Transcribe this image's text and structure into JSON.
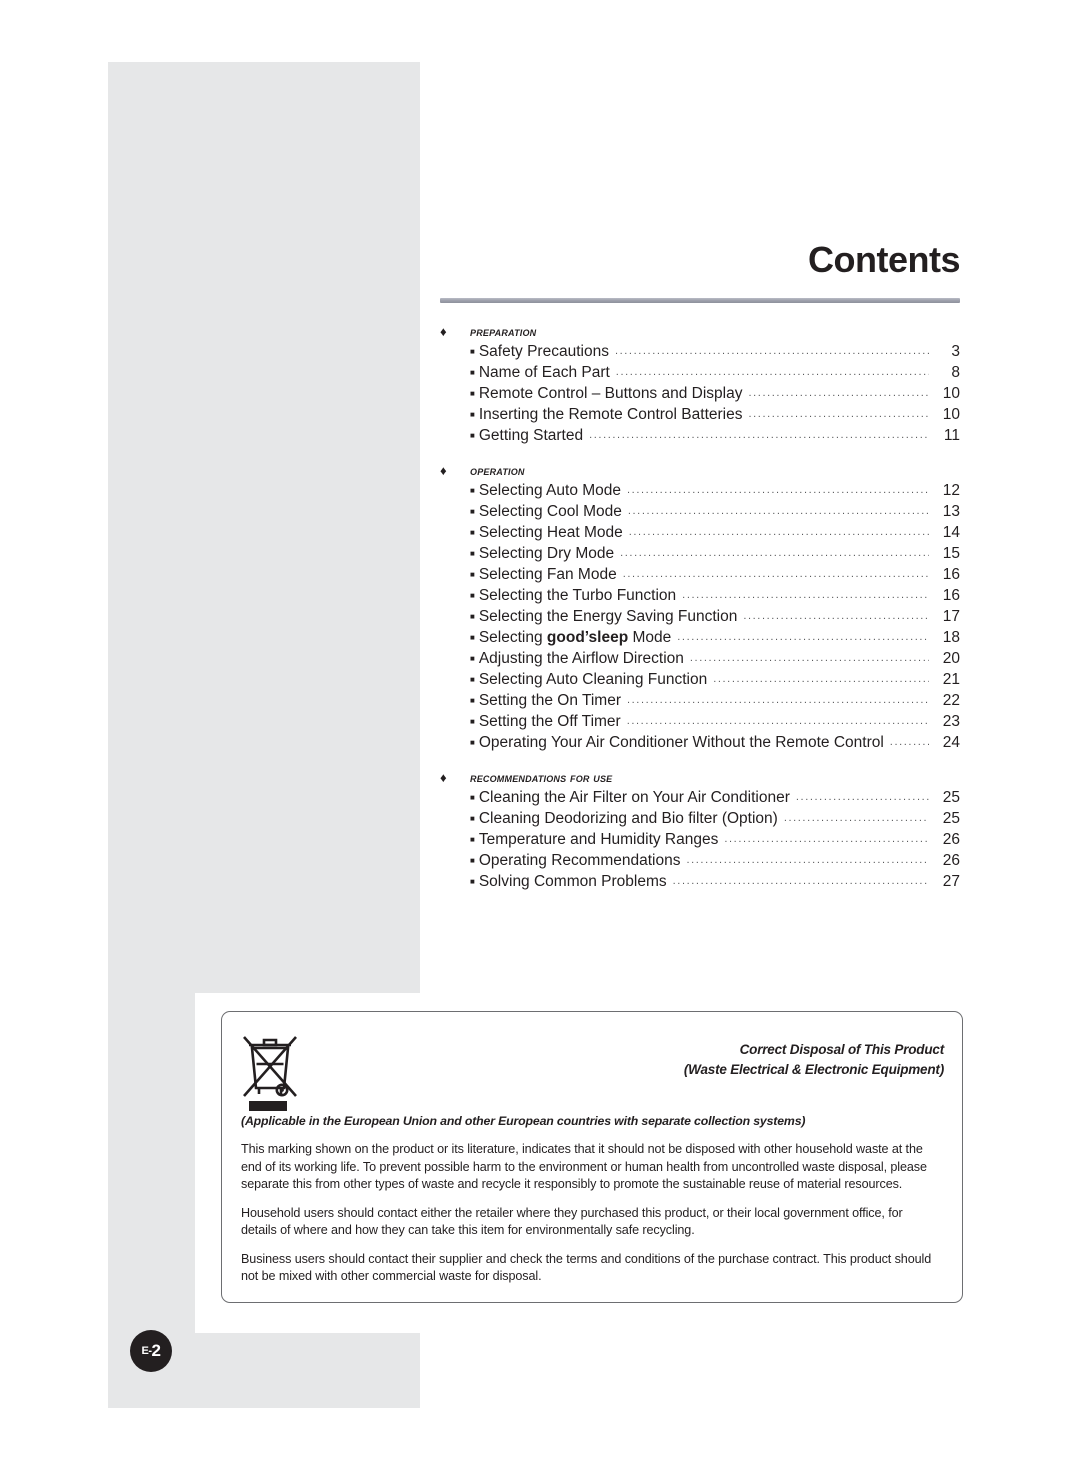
{
  "page": {
    "title": "Contents",
    "badge_prefix": "E-",
    "badge_number": "2",
    "accent_rule_color": "#9fa2ad",
    "panel_color": "#e6e7e8",
    "text_color": "#231f20"
  },
  "toc": {
    "sections": [
      {
        "label": "Preparation",
        "bullet": "diamond-bullet",
        "entries": [
          {
            "text": "Safety Precautions",
            "page": "3"
          },
          {
            "text": "Name of Each Part",
            "page": "8"
          },
          {
            "text": "Remote Control – Buttons and Display",
            "page": "10"
          },
          {
            "text": "Inserting the Remote Control Batteries",
            "page": "10"
          },
          {
            "text": "Getting Started",
            "page": "11"
          }
        ]
      },
      {
        "label": "Operation",
        "bullet": "diamond-bullet",
        "entries": [
          {
            "text": "Selecting Auto Mode",
            "page": "12"
          },
          {
            "text": "Selecting Cool Mode",
            "page": "13"
          },
          {
            "text": "Selecting Heat Mode",
            "page": "14"
          },
          {
            "text": "Selecting Dry Mode",
            "page": "15"
          },
          {
            "text": "Selecting Fan Mode",
            "page": "16"
          },
          {
            "text": "Selecting the Turbo Function",
            "page": "16"
          },
          {
            "text": "Selecting the Energy Saving Function",
            "page": "17"
          },
          {
            "text": "Selecting good’sleep Mode",
            "page": "18",
            "pre": "Selecting ",
            "bold": "good’sleep",
            "post": " Mode"
          },
          {
            "text": "Adjusting the Airflow Direction",
            "page": "20"
          },
          {
            "text": "Selecting Auto Cleaning Function",
            "page": "21"
          },
          {
            "text": "Setting the On Timer",
            "page": "22"
          },
          {
            "text": "Setting the Off Timer",
            "page": "23"
          },
          {
            "text": "Operating Your Air Conditioner Without the Remote Control",
            "page": "24"
          }
        ]
      },
      {
        "label": "Recommendations for use",
        "bullet": "diamond-bullet",
        "entries": [
          {
            "text": "Cleaning the Air Filter on Your Air Conditioner",
            "page": "25"
          },
          {
            "text": "Cleaning Deodorizing and Bio filter (Option)",
            "page": "25"
          },
          {
            "text": "Temperature and Humidity Ranges",
            "page": "26"
          },
          {
            "text": "Operating Recommendations",
            "page": "26"
          },
          {
            "text": "Solving Common Problems",
            "page": "27"
          }
        ]
      }
    ]
  },
  "disposal_notice": {
    "icon": "crossed-out-wheelie-bin-icon",
    "title_line1": "Correct Disposal of This Product",
    "title_line2": "(Waste Electrical & Electronic Equipment)",
    "applicable": "(Applicable in the European Union and other European countries with separate collection systems)",
    "paragraphs": [
      "This marking shown on the product or its literature, indicates that it should not be disposed with other household waste at the end of its working life. To prevent possible harm to the environment or human health from uncontrolled waste disposal, please separate this from other types of waste and recycle it responsibly to promote the sustainable reuse of material resources.",
      "Household users should contact either the retailer where they purchased this product, or their local government office, for details of where and how they can take this item for environmentally safe recycling.",
      "Business users should contact their supplier and check the terms and conditions of the purchase contract. This product should not be mixed with other commercial waste for disposal."
    ]
  }
}
